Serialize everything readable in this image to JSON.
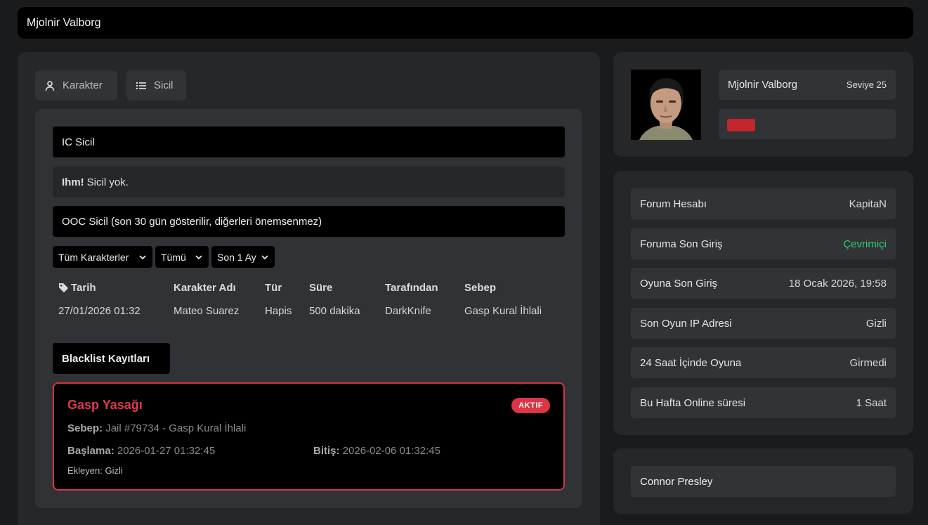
{
  "header": {
    "title": "Mjolnir Valborg"
  },
  "tabs": [
    {
      "label": "Karakter",
      "icon": "user-icon"
    },
    {
      "label": "Sicil",
      "icon": "list-icon"
    }
  ],
  "record": {
    "ic_title": "IC Sicil",
    "ic_note_bold": "Ihm!",
    "ic_note_text": "Sicil yok.",
    "ooc_title": "OOC Sicil (son 30 gün gösterilir, diğerleri önemsenmez)",
    "filters": [
      {
        "value": "Tüm Karakterler"
      },
      {
        "value": "Tümü"
      },
      {
        "value": "Son 1 Ay"
      }
    ],
    "table": {
      "headers": [
        "Tarih",
        "Karakter Adı",
        "Tür",
        "Süre",
        "Tarafından",
        "Sebep"
      ],
      "rows": [
        [
          "27/01/2026 01:32",
          "Mateo Suarez",
          "Hapis",
          "500 dakika",
          "DarkKnife",
          "Gasp Kural İhlali"
        ]
      ]
    }
  },
  "blacklist": {
    "title": "Blacklist Kayıtları",
    "entry": {
      "name": "Gasp Yasağı",
      "status": "AKTIF",
      "reason_label": "Sebep:",
      "reason": "Jail #79734 - Gasp Kural İhlali",
      "start_label": "Başlama:",
      "start": "2026-01-27 01:32:45",
      "end_label": "Bitiş:",
      "end": "2026-02-06 01:32:45",
      "added_by": "Ekleyen: Gizli"
    }
  },
  "profile": {
    "name": "Mjolnir Valborg",
    "level": "Seviye 25",
    "tag_color": "#c0262c"
  },
  "info": [
    {
      "key": "Forum Hesabı",
      "value": "KapitaN"
    },
    {
      "key": "Foruma Son Giriş",
      "value": "Çevrimiçi"
    },
    {
      "key": "Oyuna Son Giriş",
      "value": "18 Ocak 2026, 19:58"
    },
    {
      "key": "Son Oyun IP Adresi",
      "value": "Gizli"
    },
    {
      "key": "24 Saat İçinde Oyuna",
      "value": "Girmedi"
    },
    {
      "key": "Bu Hafta Online süresi",
      "value": "1 Saat"
    }
  ],
  "characters": [
    {
      "name": "Connor Presley"
    }
  ],
  "colors": {
    "accent_red": "#dc3545",
    "online_green": "#2ecc71"
  }
}
